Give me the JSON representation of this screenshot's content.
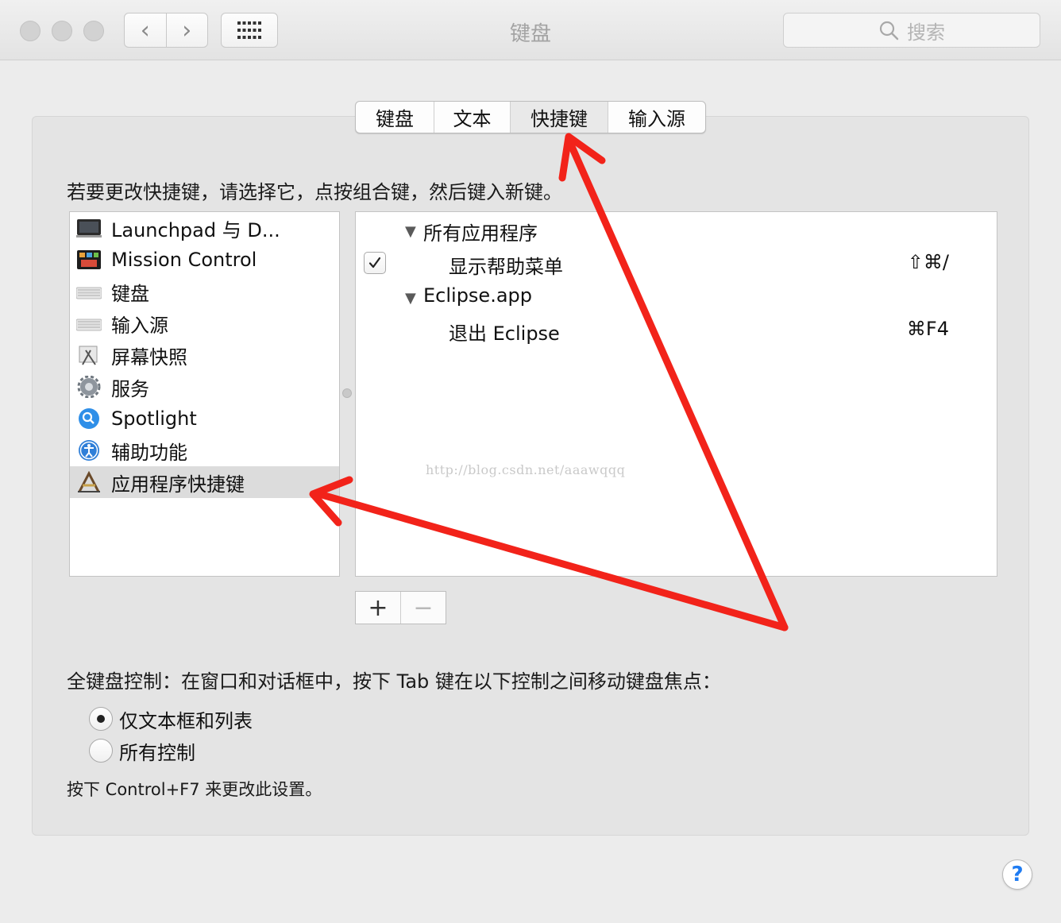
{
  "window": {
    "title": "键盘",
    "nav_back": "‹",
    "nav_forward": "›",
    "search_placeholder": "搜索"
  },
  "tabs": [
    {
      "label": "键盘",
      "active": false
    },
    {
      "label": "文本",
      "active": false
    },
    {
      "label": "快捷键",
      "active": true
    },
    {
      "label": "输入源",
      "active": false
    }
  ],
  "instruction": "若要更改快捷键，请选择它，点按组合键，然后键入新键。",
  "categories": [
    {
      "label": "Launchpad 与 D...",
      "icon": "launchpad-icon",
      "selected": false
    },
    {
      "label": "Mission Control",
      "icon": "mission-control-icon",
      "selected": false
    },
    {
      "label": "键盘",
      "icon": "keyboard-icon",
      "selected": false
    },
    {
      "label": "输入源",
      "icon": "keyboard-icon",
      "selected": false
    },
    {
      "label": "屏幕快照",
      "icon": "screenshot-icon",
      "selected": false
    },
    {
      "label": "服务",
      "icon": "gear-icon",
      "selected": false
    },
    {
      "label": "Spotlight",
      "icon": "spotlight-icon",
      "selected": false
    },
    {
      "label": "辅助功能",
      "icon": "accessibility-icon",
      "selected": false
    },
    {
      "label": "应用程序快捷键",
      "icon": "app-shortcuts-icon",
      "selected": true
    }
  ],
  "shortcuts": {
    "groups": [
      {
        "label": "所有应用程序",
        "expanded": true,
        "items": [
          {
            "label": "显示帮助菜单",
            "keys": "⇧⌘/",
            "checked": true
          }
        ]
      },
      {
        "label": "Eclipse.app",
        "expanded": true,
        "items": [
          {
            "label": "退出 Eclipse",
            "keys": "⌘F4",
            "checked": false
          }
        ]
      }
    ]
  },
  "watermark": "http://blog.csdn.net/aaawqqq",
  "buttons": {
    "add": "+",
    "remove": "−"
  },
  "full_keyboard": {
    "label": "全键盘控制：在窗口和对话框中，按下 Tab 键在以下控制之间移动键盘焦点：",
    "options": [
      {
        "label": "仅文本框和列表",
        "selected": true
      },
      {
        "label": "所有控制",
        "selected": false
      }
    ]
  },
  "hint": "按下 Control+F7 来更改此设置。",
  "help": "?",
  "colors": {
    "annotation_arrow": "#f2231a",
    "help_accent": "#1f7cf2"
  }
}
